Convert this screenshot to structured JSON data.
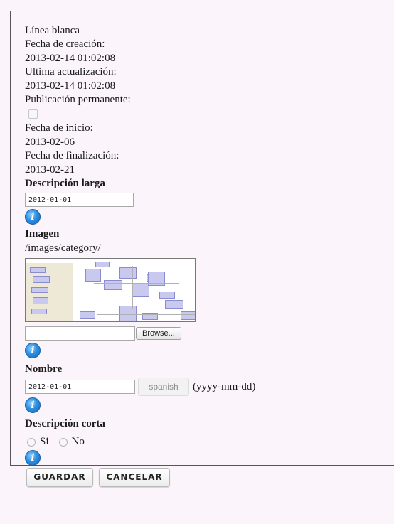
{
  "meta": {
    "category_name": "Línea blanca",
    "created_label": "Fecha de creación:",
    "created_value": "2013-02-14 01:02:08",
    "updated_label": "Ultima actualización:",
    "updated_value": "2013-02-14 01:02:08",
    "permanent_label": "Publicación permanente:",
    "start_label": "Fecha de inicio:",
    "start_value": "2013-02-06",
    "end_label": "Fecha de finalización:",
    "end_value": "2013-02-21"
  },
  "long_description": {
    "label": "Descripción larga",
    "value": "2012-01-01"
  },
  "image": {
    "label": "Imagen",
    "path": "/images/category/",
    "browse_label": "Browse..."
  },
  "name": {
    "label": "Nombre",
    "value": "2012-01-01",
    "language": "spanish",
    "format_hint": "(yyyy-mm-dd)"
  },
  "short_description": {
    "label": "Descripción corta",
    "option_yes": "Si",
    "option_no": "No"
  },
  "info_icon_glyph": "i",
  "actions": {
    "save_label": "GUARDAR",
    "cancel_label": "CANCELAR"
  }
}
